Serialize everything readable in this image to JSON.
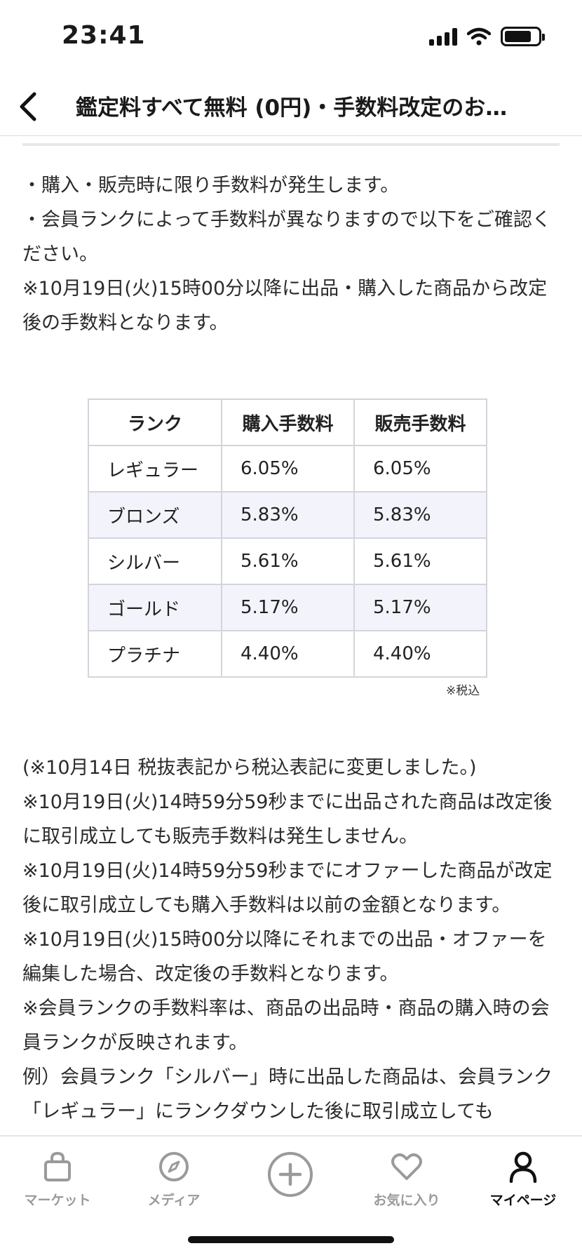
{
  "status_bar": {
    "time": "23:41"
  },
  "header": {
    "title": "鑑定料すべて無料 (0円)・手数料改定のお…"
  },
  "intro": [
    "・購入・販売時に限り手数料が発生します。",
    "・会員ランクによって手数料が異なりますので以下をご確認ください。",
    "※10月19日(火)15時00分以降に出品・購入した商品から改定後の手数料となります。"
  ],
  "fee_table": {
    "headers": [
      "ランク",
      "購入手数料",
      "販売手数料"
    ],
    "rows": [
      [
        "レギュラー",
        "6.05%",
        "6.05%"
      ],
      [
        "ブロンズ",
        "5.83%",
        "5.83%"
      ],
      [
        "シルバー",
        "5.61%",
        "5.61%"
      ],
      [
        "ゴールド",
        "5.17%",
        "5.17%"
      ],
      [
        "プラチナ",
        "4.40%",
        "4.40%"
      ]
    ],
    "note": "※税込"
  },
  "notes": [
    "(※10月14日 税抜表記から税込表記に変更しました。)",
    "※10月19日(火)14時59分59秒までに出品された商品は改定後に取引成立しても販売手数料は発生しません。",
    "※10月19日(火)14時59分59秒までにオファーした商品が改定後に取引成立しても購入手数料は以前の金額となります。",
    "※10月19日(火)15時00分以降にそれまでの出品・オファーを編集した場合、改定後の手数料となります。",
    "※会員ランクの手数料率は、商品の出品時・商品の購入時の会員ランクが反映されます。",
    "例）会員ランク「シルバー」時に出品した商品は、会員ランク「レギュラー」にランクダウンした後に取引成立しても"
  ],
  "tab_bar": {
    "market": "マーケット",
    "media": "メディア",
    "favorites": "お気に入り",
    "mypage": "マイページ"
  }
}
